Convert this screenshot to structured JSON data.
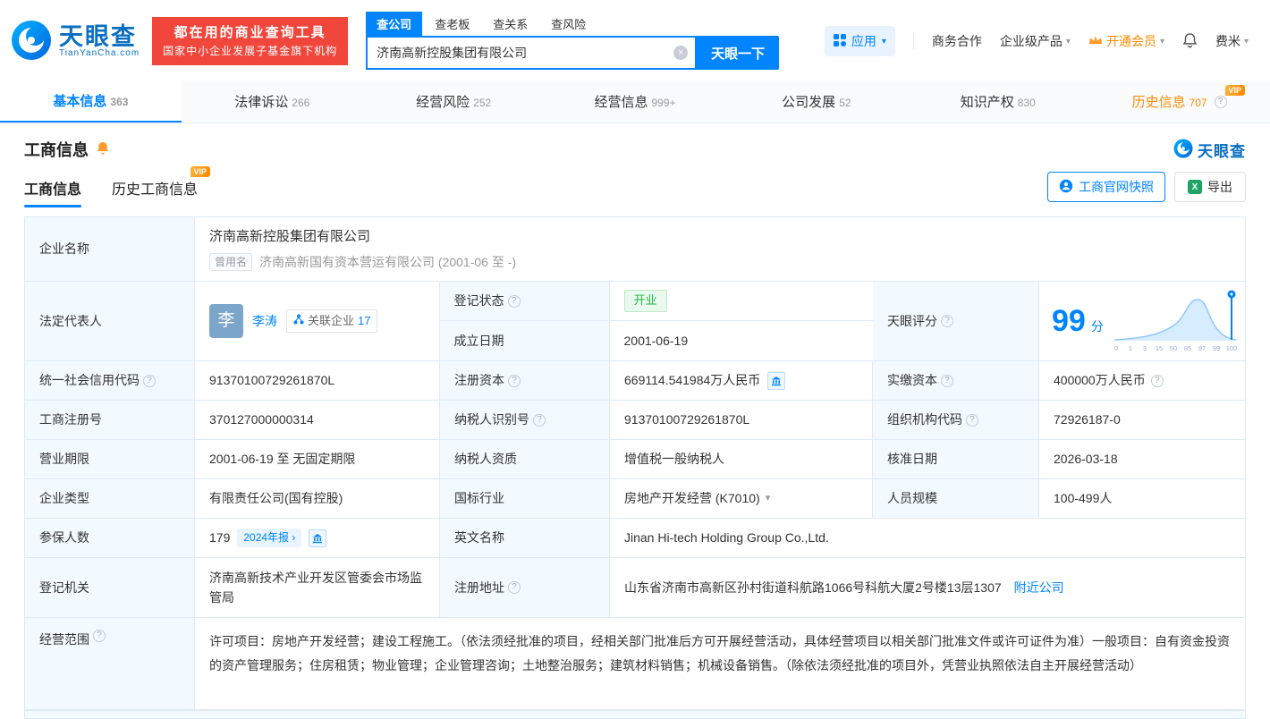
{
  "brand": {
    "name": "天眼查",
    "domain": "TianYanCha.com",
    "color": "#0084ff"
  },
  "promo": {
    "line1": "都在用的商业查询工具",
    "line2": "国家中小企业发展子基金旗下机构"
  },
  "search": {
    "tabs": {
      "t0": "查公司",
      "t1": "查老板",
      "t2": "查关系",
      "t3": "查风险"
    },
    "value": "济南高新控股集团有限公司",
    "button": "天眼一下"
  },
  "topnav": {
    "apps": "应用",
    "biz": "商务合作",
    "enterprise": "企业级产品",
    "vip": "开通会员",
    "user": "费米"
  },
  "tabs": {
    "t0": {
      "label": "基本信息",
      "count": "363"
    },
    "t1": {
      "label": "法律诉讼",
      "count": "266"
    },
    "t2": {
      "label": "经营风险",
      "count": "252"
    },
    "t3": {
      "label": "经营信息",
      "count": "999+"
    },
    "t4": {
      "label": "公司发展",
      "count": "52"
    },
    "t5": {
      "label": "知识产权",
      "count": "830"
    },
    "t6": {
      "label": "历史信息",
      "count": "707",
      "vip": "VIP"
    }
  },
  "section": {
    "title": "工商信息",
    "watermark": "天眼查",
    "subtab_active": "工商信息",
    "subtab_history": "历史工商信息",
    "vip": "VIP",
    "snapshot": "工商官网快照",
    "export": "导出"
  },
  "info": {
    "company_name": {
      "label": "企业名称",
      "value": "济南高新控股集团有限公司",
      "former_tag": "曾用名",
      "former_value": "济南高新国有资本营运有限公司 (2001-06 至 -)"
    },
    "legal_rep": {
      "label": "法定代表人",
      "avatar": "李",
      "name": "李涛",
      "related": "关联企业",
      "related_count": "17"
    },
    "reg_status": {
      "label": "登记状态",
      "value": "开业"
    },
    "est_date": {
      "label": "成立日期",
      "value": "2001-06-19"
    },
    "score": {
      "label": "天眼评分",
      "value": "99",
      "unit": "分",
      "axis": [
        "0",
        "1",
        "3",
        "15",
        "50",
        "85",
        "97",
        "99",
        "100"
      ]
    },
    "credit_code": {
      "label": "统一社会信用代码",
      "value": "91370100729261870L"
    },
    "reg_capital": {
      "label": "注册资本",
      "value": "669114.541984万人民币"
    },
    "paid_capital": {
      "label": "实缴资本",
      "value": "400000万人民币"
    },
    "reg_number": {
      "label": "工商注册号",
      "value": "370127000000314"
    },
    "taxpayer_id": {
      "label": "纳税人识别号",
      "value": "91370100729261870L"
    },
    "org_code": {
      "label": "组织机构代码",
      "value": "72926187-0"
    },
    "biz_term": {
      "label": "营业期限",
      "value": "2001-06-19 至 无固定期限"
    },
    "taxpayer_quality": {
      "label": "纳税人资质",
      "value": "增值税一般纳税人"
    },
    "approve_date": {
      "label": "核准日期",
      "value": "2026-03-18"
    },
    "company_type": {
      "label": "企业类型",
      "value": "有限责任公司(国有控股)"
    },
    "industry": {
      "label": "国标行业",
      "value": "房地产开发经营 (K7010)"
    },
    "staff_size": {
      "label": "人员规模",
      "value": "100-499人"
    },
    "insured": {
      "label": "参保人数",
      "value": "179",
      "report_badge": "2024年报"
    },
    "english_name": {
      "label": "英文名称",
      "value": "Jinan Hi-tech Holding Group Co.,Ltd."
    },
    "reg_authority": {
      "label": "登记机关",
      "value": "济南高新技术产业开发区管委会市场监管局"
    },
    "address": {
      "label": "注册地址",
      "value": "山东省济南市高新区孙村街道科航路1066号科航大厦2号楼13层1307",
      "nearby": "附近公司"
    },
    "biz_scope": {
      "label": "经营范围",
      "value": "许可项目：房地产开发经营；建设工程施工。（依法须经批准的项目，经相关部门批准后方可开展经营活动，具体经营项目以相关部门批准文件或许可证件为准）一般项目：自有资金投资的资产管理服务；住房租赁；物业管理；企业管理咨询；土地整治服务；建筑材料销售；机械设备销售。（除依法须经批准的项目外，凭营业执照依法自主开展经营活动）"
    }
  }
}
